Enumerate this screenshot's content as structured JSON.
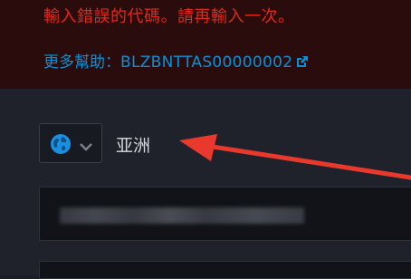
{
  "error": {
    "message": "輸入錯誤的代碼。請再輸入一次。",
    "help_label": "更多幫助：",
    "help_code": "BLZBNTTAS00000002"
  },
  "region": {
    "label": "亚洲",
    "icon": "globe-icon"
  },
  "colors": {
    "error_red": "#e0281c",
    "link_blue": "#0a90d8",
    "annotation_red": "#e8392c"
  }
}
